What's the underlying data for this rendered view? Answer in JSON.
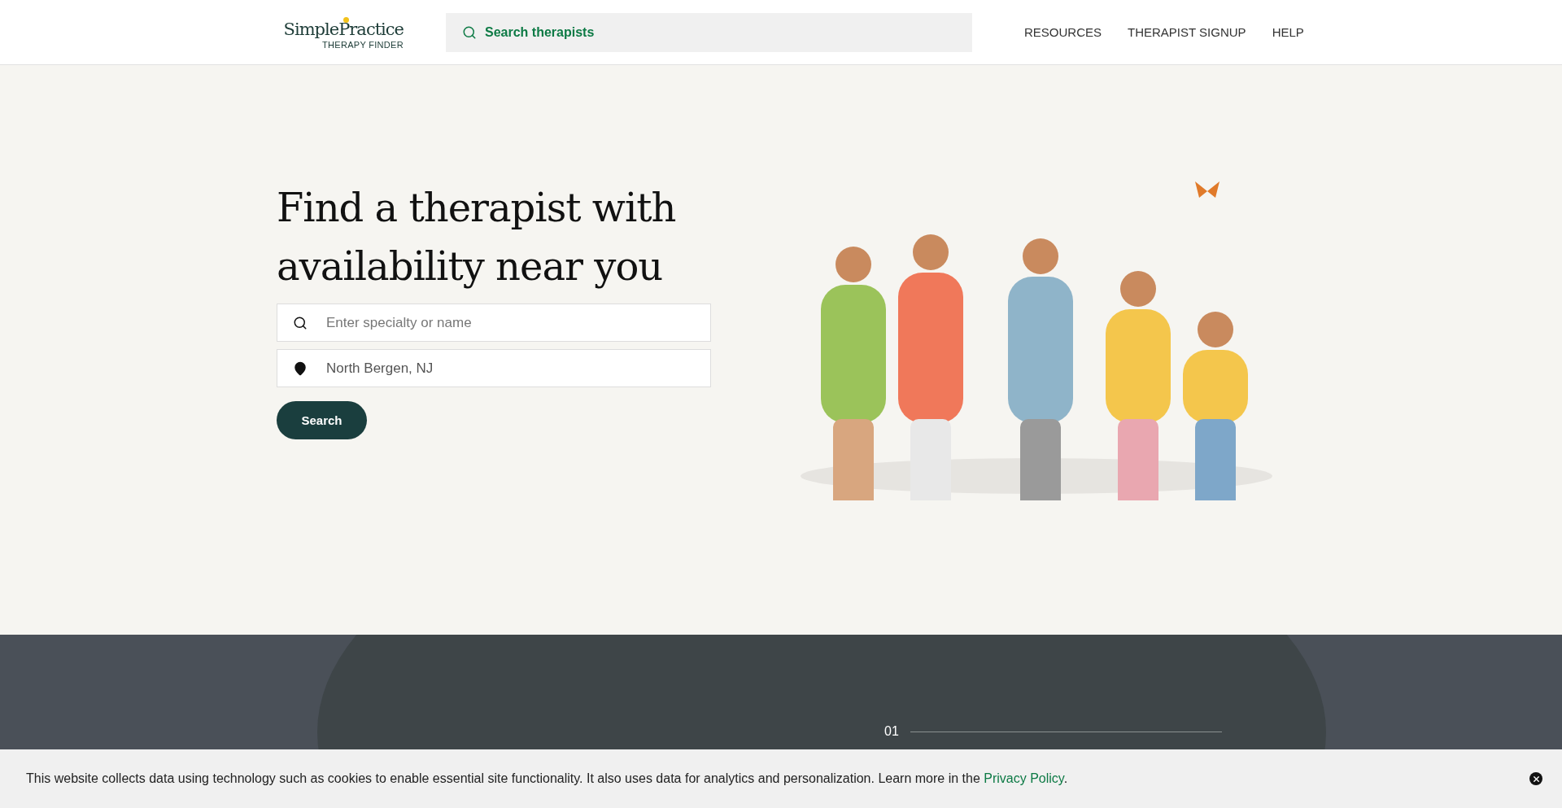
{
  "header": {
    "logo": {
      "name": "SimplePractice",
      "subtitle": "THERAPY FINDER"
    },
    "search": {
      "placeholder": "Search therapists"
    },
    "nav": [
      "RESOURCES",
      "THERAPIST SIGNUP",
      "HELP"
    ]
  },
  "hero": {
    "title_lines": [
      "Find a therapist with",
      "availability near you"
    ],
    "fields": [
      {
        "kind": "search",
        "placeholder": "Enter specialty or name"
      },
      {
        "kind": "location",
        "value": "North Bergen, NJ"
      }
    ],
    "button": "Search"
  },
  "steps": {
    "number": "01"
  },
  "cookie_banner": {
    "text": "This website collects data using technology such as cookies to enable essential site functionality. It also uses data for analytics and personalization. Learn more in the ",
    "link": "Privacy Policy",
    "text_after": "."
  }
}
